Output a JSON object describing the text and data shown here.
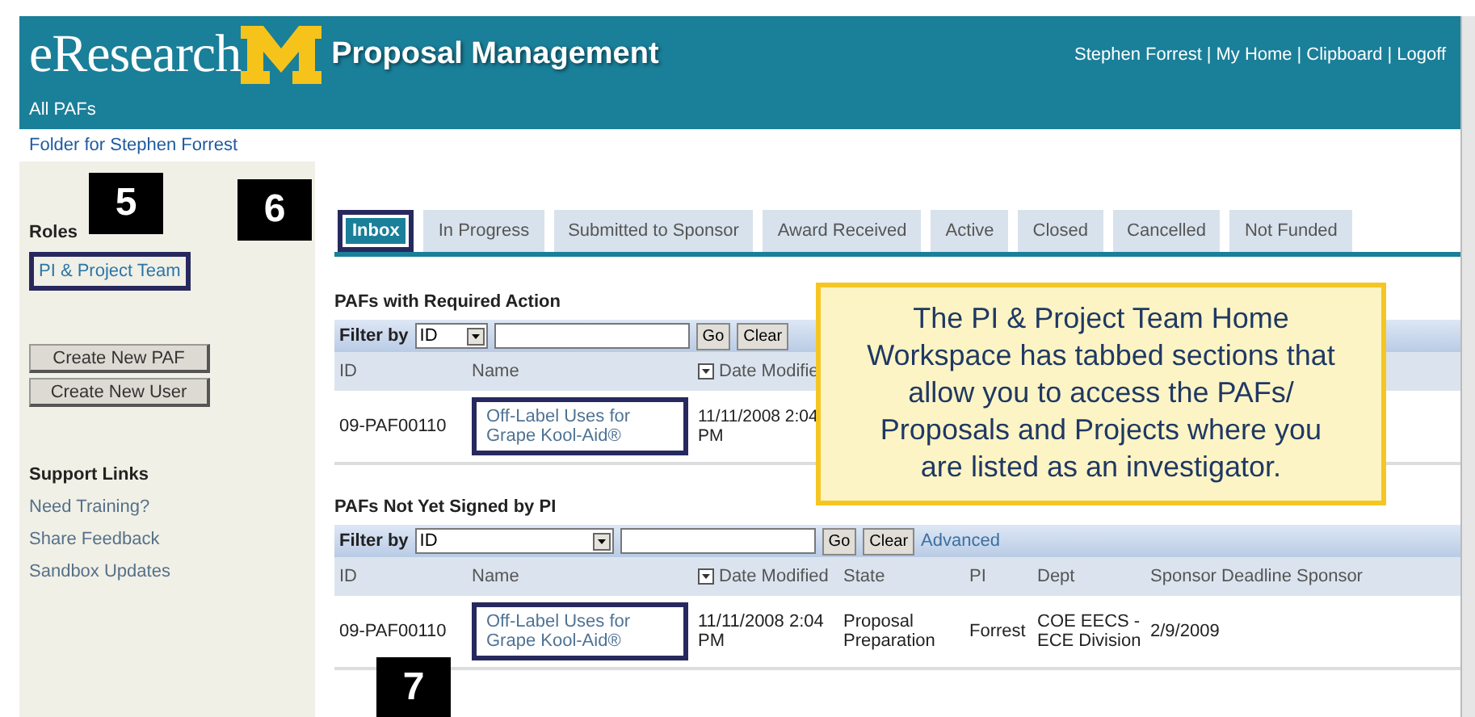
{
  "header": {
    "logo_text": "eResearch",
    "title": "Proposal Management",
    "user_links": [
      "Stephen Forrest",
      "My Home",
      "Clipboard",
      "Logoff"
    ],
    "separator": "|",
    "nav": "All PAFs"
  },
  "breadcrumb": "Folder for Stephen Forrest",
  "sidebar": {
    "roles_heading": "Roles",
    "roles": [
      {
        "label": "PI & Project Team",
        "highlighted": true
      }
    ],
    "buttons": [
      "Create New PAF",
      "Create New User"
    ],
    "support_heading": "Support Links",
    "links": [
      "Need Training?",
      "Share Feedback",
      "Sandbox Updates"
    ]
  },
  "tabs": [
    {
      "label": "Inbox",
      "selected": true,
      "highlighted": true
    },
    {
      "label": "In Progress",
      "selected": false,
      "highlighted": false
    },
    {
      "label": "Submitted to Sponsor",
      "selected": false,
      "highlighted": false
    },
    {
      "label": "Award Received",
      "selected": false,
      "highlighted": false
    },
    {
      "label": "Active",
      "selected": false,
      "highlighted": false
    },
    {
      "label": "Closed",
      "selected": false,
      "highlighted": false
    },
    {
      "label": "Cancelled",
      "selected": false,
      "highlighted": false
    },
    {
      "label": "Not Funded",
      "selected": false,
      "highlighted": false
    }
  ],
  "sections": [
    {
      "title": "PAFs with Required Action",
      "filter": {
        "label": "Filter by",
        "select": "ID",
        "go": "Go",
        "clear": "Clear"
      },
      "columns": [
        "ID",
        "Name",
        "Date Modifie"
      ],
      "rows": [
        {
          "cells": [
            "09-PAF00110",
            "Off-Label Uses for Grape Kool-Aid®",
            "11/11/2008 2:04 PM"
          ],
          "highlighted": true
        }
      ]
    },
    {
      "title": "PAFs Not Yet Signed by PI",
      "filter": {
        "label": "Filter by",
        "select": "ID",
        "go": "Go",
        "clear": "Clear",
        "advanced": "Advanced"
      },
      "columns": [
        "ID",
        "Name",
        "Date Modified",
        "State",
        "PI",
        "Dept",
        "Sponsor Deadline Sponsor"
      ],
      "rows": [
        {
          "cells": [
            "09-PAF00110",
            "Off-Label Uses for Grape Kool-Aid®",
            "11/11/2008 2:04 PM",
            "Proposal Preparation",
            "Forrest",
            "COE EECS - ECE Division",
            "2/9/2009"
          ],
          "highlighted": true
        }
      ]
    }
  ],
  "callouts": [
    "5",
    "6",
    "7"
  ],
  "note": "The PI & Project Team Home Workspace has tabbed sections that allow you to access the PAFs/ Proposals and Projects where you are listed as an investigator."
}
